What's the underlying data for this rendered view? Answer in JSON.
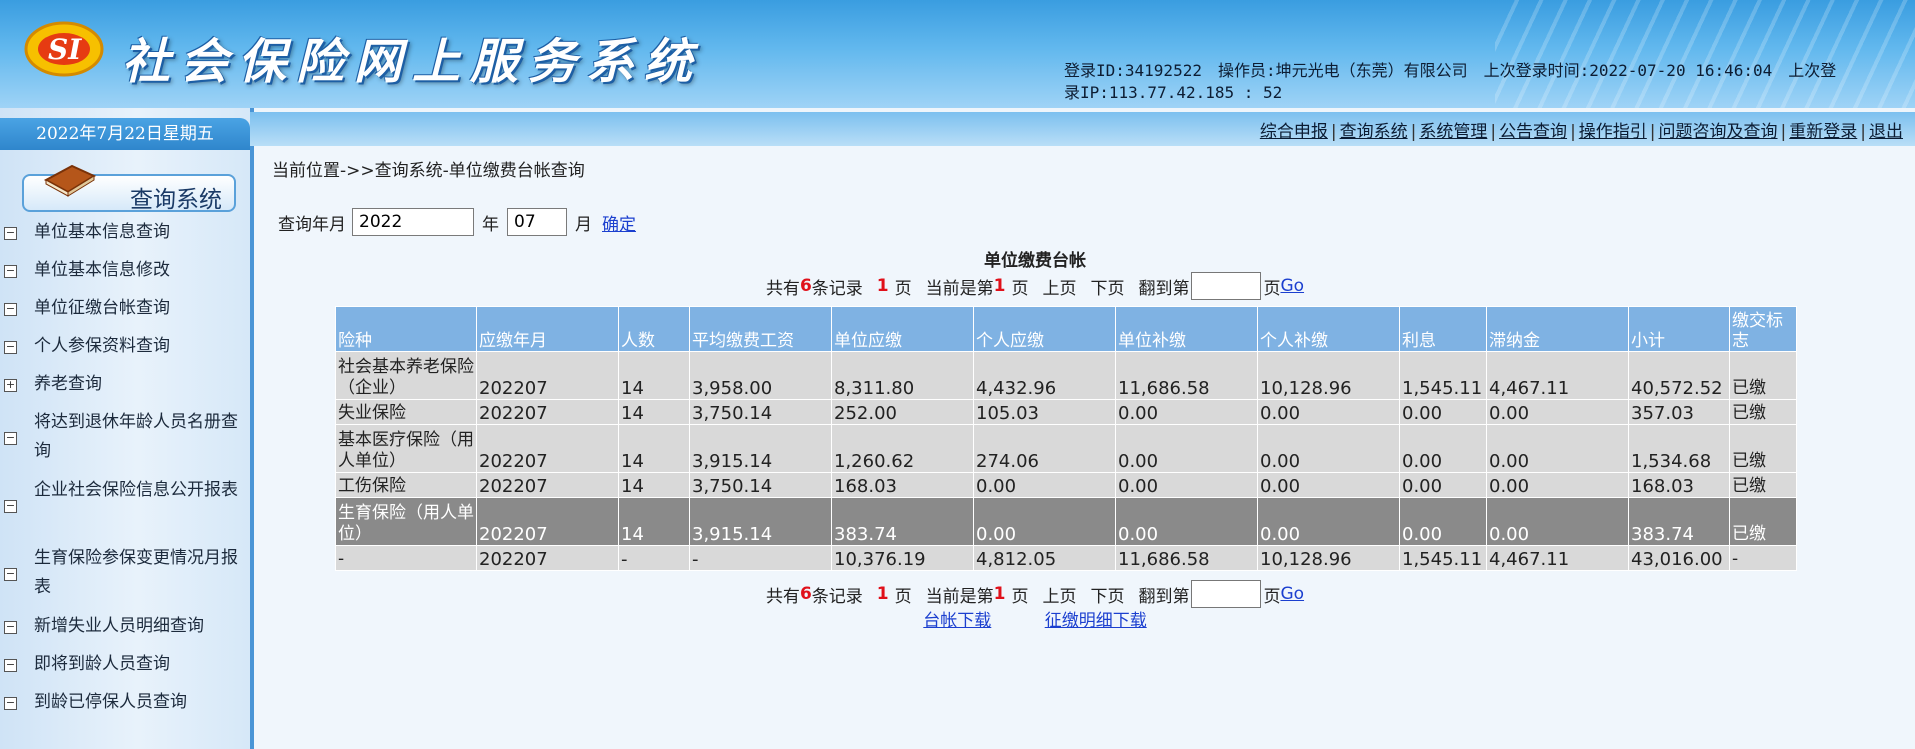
{
  "header": {
    "system_title": "社会保险网上服务系统",
    "logo_text": "SI",
    "login_id": "登录ID:34192522",
    "operator": "操作员:坤元光电（东莞）有限公司",
    "last_login_time": "上次登录时间:2022-07-20 16:46:04",
    "last_login_ip_line1": "上次登",
    "last_login_ip_line2": "录IP:113.77.42.185 :  52"
  },
  "sidebar": {
    "date": "2022年7月22日星期五",
    "module_title": "查询系统",
    "items": [
      {
        "label": "单位基本信息查询",
        "box": "−"
      },
      {
        "label": "单位基本信息修改",
        "box": "−"
      },
      {
        "label": "单位征缴台帐查询",
        "box": "−"
      },
      {
        "label": "个人参保资料查询",
        "box": "−"
      },
      {
        "label": "养老查询",
        "box": "+"
      },
      {
        "label": "将达到退休年龄人员名册查询",
        "box": "−"
      },
      {
        "label": "企业社会保险信息公开报表",
        "box": "−"
      },
      {
        "label": "生育保险参保变更情况月报表",
        "box": "−"
      },
      {
        "label": "新增失业人员明细查询",
        "box": "−"
      },
      {
        "label": "即将到龄人员查询",
        "box": "−"
      },
      {
        "label": "到龄已停保人员查询",
        "box": "−"
      }
    ]
  },
  "topnav": {
    "links": [
      "综合申报",
      "查询系统",
      "系统管理",
      "公告查询",
      "操作指引",
      "问题咨询及查询",
      "重新登录",
      "退出"
    ]
  },
  "main": {
    "breadcrumb": "当前位置->>查询系统-单位缴费台帐查询",
    "query": {
      "label_year_prefix": "查询年月",
      "year_value": "2022",
      "label_year": "年",
      "month_value": "07",
      "label_month": "月",
      "confirm": "确定"
    },
    "table_title": "单位缴费台帐",
    "pager": {
      "total_prefix": "共有",
      "total_count": "6",
      "total_suffix": "条记录",
      "pages": "1",
      "pages_suffix": "页",
      "current_prefix": "当前是第",
      "current_page": "1",
      "current_suffix": "页",
      "prev": "上页",
      "next": "下页",
      "goto_prefix": "翻到第",
      "goto_suffix": "页",
      "go": "Go"
    },
    "columns": [
      "险种",
      "应缴年月",
      "人数",
      "平均缴费工资",
      "单位应缴",
      "个人应缴",
      "单位补缴",
      "个人补缴",
      "利息",
      "滞纳金",
      "小计",
      "缴交标志"
    ],
    "rows": [
      [
        "社会基本养老保险（企业）",
        "202207",
        "14",
        "3,958.00",
        "8,311.80",
        "4,432.96",
        "11,686.58",
        "10,128.96",
        "1,545.11",
        "4,467.11",
        "40,572.52",
        "已缴"
      ],
      [
        "失业保险",
        "202207",
        "14",
        "3,750.14",
        "252.00",
        "105.03",
        "0.00",
        "0.00",
        "0.00",
        "0.00",
        "357.03",
        "已缴"
      ],
      [
        "基本医疗保险（用人单位）",
        "202207",
        "14",
        "3,915.14",
        "1,260.62",
        "274.06",
        "0.00",
        "0.00",
        "0.00",
        "0.00",
        "1,534.68",
        "已缴"
      ],
      [
        "工伤保险",
        "202207",
        "14",
        "3,750.14",
        "168.03",
        "0.00",
        "0.00",
        "0.00",
        "0.00",
        "0.00",
        "168.03",
        "已缴"
      ],
      [
        "生育保险（用人单位）",
        "202207",
        "14",
        "3,915.14",
        "383.74",
        "0.00",
        "0.00",
        "0.00",
        "0.00",
        "0.00",
        "383.74",
        "已缴"
      ],
      [
        "-",
        "202207",
        "-",
        "-",
        "10,376.19",
        "4,812.05",
        "11,686.58",
        "10,128.96",
        "1,545.11",
        "4,467.11",
        "43,016.00",
        "-"
      ]
    ],
    "downloads": [
      "台帐下载",
      "征缴明细下载"
    ]
  }
}
